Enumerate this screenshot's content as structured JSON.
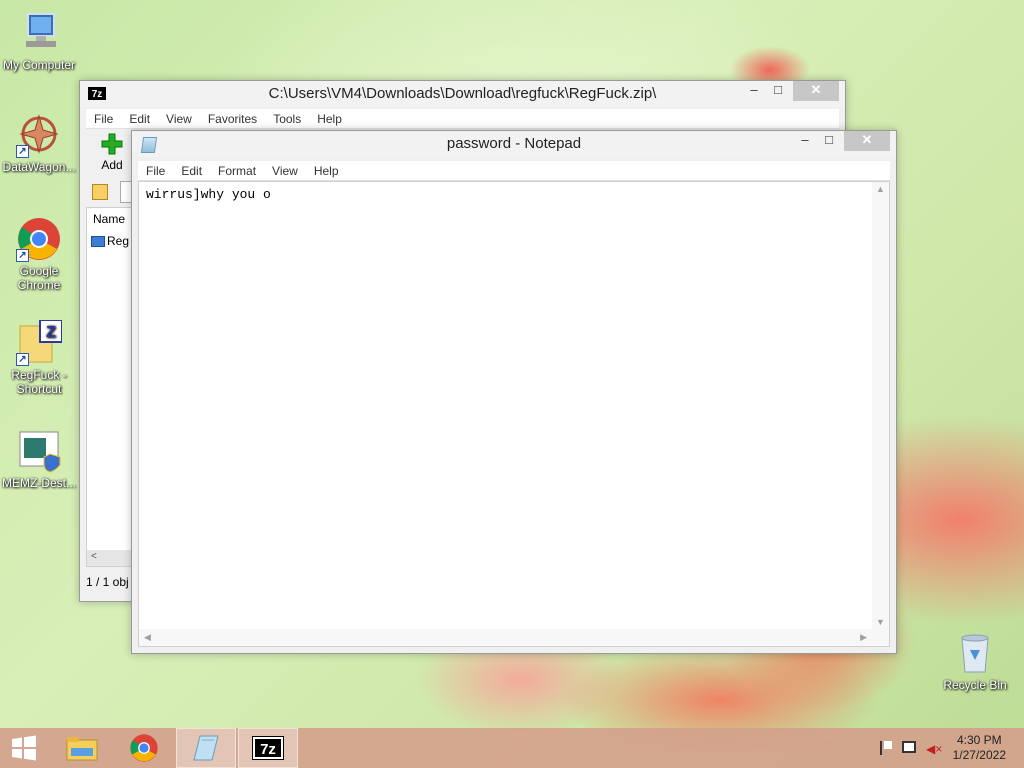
{
  "desktop": {
    "icons": [
      {
        "label": "My Computer",
        "icon": "computer-icon"
      },
      {
        "label": "DataWagon...",
        "icon": "datawagon-icon"
      },
      {
        "label": "Google Chrome",
        "icon": "chrome-icon"
      },
      {
        "label": "RegFuck - Shortcut",
        "icon": "regfuck-icon"
      },
      {
        "label": "MEMZ-Dest...",
        "icon": "memz-icon"
      },
      {
        "label": "Recycle Bin",
        "icon": "recycle-bin-icon"
      }
    ]
  },
  "zip_window": {
    "title": "C:\\Users\\VM4\\Downloads\\Download\\regfuck\\RegFuck.zip\\",
    "app_icon_text": "7z",
    "menu": [
      "File",
      "Edit",
      "View",
      "Favorites",
      "Tools",
      "Help"
    ],
    "add_label": "Add",
    "column_name": "Name",
    "row_item": "Reg",
    "status": "1 / 1 obj"
  },
  "notepad_window": {
    "title": "password - Notepad",
    "menu": [
      "File",
      "Edit",
      "Format",
      "View",
      "Help"
    ],
    "content": "wirrus]why you o"
  },
  "window_controls": {
    "minimize": "–",
    "maximize": "□",
    "close": "✕"
  },
  "taskbar": {
    "items": [
      "start-icon",
      "file-explorer-icon",
      "chrome-icon",
      "notepad-icon",
      "7zip-icon"
    ],
    "zip_text": "7z",
    "time": "4:30 PM",
    "date": "1/27/2022"
  },
  "colors": {
    "taskbar": "#d4a08c",
    "close_button": "#c7c7c7",
    "add_green": "#22b022"
  }
}
